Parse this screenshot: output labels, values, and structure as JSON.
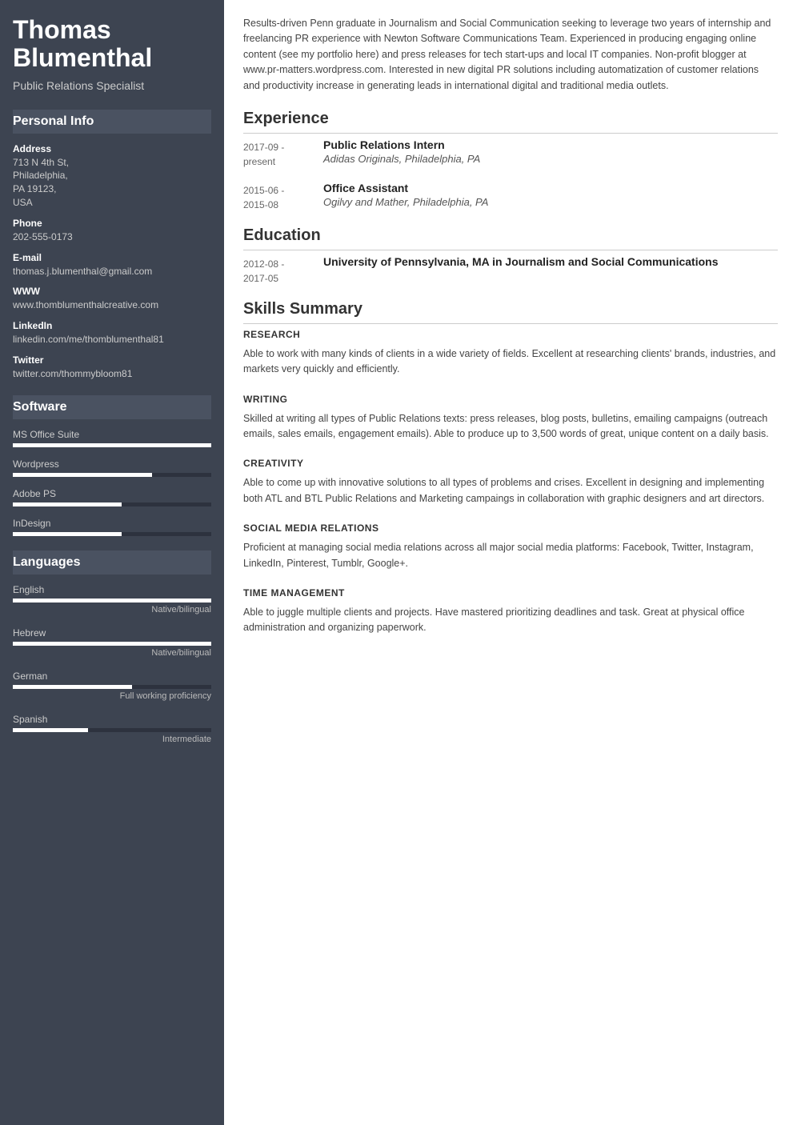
{
  "sidebar": {
    "name": "Thomas Blumenthal",
    "title": "Public Relations Specialist",
    "sections": {
      "personal_info": "Personal Info",
      "software": "Software",
      "languages": "Languages"
    },
    "personal": {
      "address_label": "Address",
      "address_value": "713 N 4th St, Philadelphia, PA 19123, USA",
      "phone_label": "Phone",
      "phone_value": "202-555-0173",
      "email_label": "E-mail",
      "email_value": "thomas.j.blumenthal@gmail.com",
      "www_label": "WWW",
      "www_value": "www.thomblumenthalcreative.com",
      "linkedin_label": "LinkedIn",
      "linkedin_value": "linkedin.com/me/thomblumenthal81",
      "twitter_label": "Twitter",
      "twitter_value": "twitter.com/thommybloom81"
    },
    "software": [
      {
        "name": "MS Office Suite",
        "fill_pct": 100,
        "dark_pct": 0
      },
      {
        "name": "Wordpress",
        "fill_pct": 70,
        "dark_pct": 30
      },
      {
        "name": "Adobe PS",
        "fill_pct": 55,
        "dark_pct": 45
      },
      {
        "name": "InDesign",
        "fill_pct": 55,
        "dark_pct": 45
      }
    ],
    "languages": [
      {
        "name": "English",
        "fill_pct": 100,
        "dark_pct": 0,
        "level": "Native/bilingual"
      },
      {
        "name": "Hebrew",
        "fill_pct": 100,
        "dark_pct": 0,
        "level": "Native/bilingual"
      },
      {
        "name": "German",
        "fill_pct": 60,
        "dark_pct": 40,
        "level": "Full working proficiency"
      },
      {
        "name": "Spanish",
        "fill_pct": 38,
        "dark_pct": 62,
        "level": "Intermediate"
      }
    ]
  },
  "main": {
    "summary": "Results-driven Penn graduate in Journalism and Social Communication seeking to leverage two years of internship and freelancing PR experience with Newton Software Communications Team. Experienced in producing engaging online content (see my portfolio here) and press releases for tech start-ups and local IT companies. Non-profit blogger at www.pr-matters.wordpress.com. Interested in new digital PR solutions including automatization of customer relations and productivity increase in generating leads in international digital and traditional media outlets.",
    "experience_title": "Experience",
    "experience": [
      {
        "date": "2017-09 - present",
        "title": "Public Relations Intern",
        "subtitle": "Adidas Originals, Philadelphia, PA"
      },
      {
        "date": "2015-06 - 2015-08",
        "title": "Office Assistant",
        "subtitle": "Ogilvy and Mather, Philadelphia, PA"
      }
    ],
    "education_title": "Education",
    "education": [
      {
        "date": "2012-08 - 2017-05",
        "title": "University of Pennsylvania, MA in Journalism and Social Communications",
        "subtitle": ""
      }
    ],
    "skills_title": "Skills Summary",
    "skills": [
      {
        "category": "RESEARCH",
        "text": "Able to work with many kinds of clients in a wide variety of fields. Excellent at researching clients' brands, industries, and markets very quickly and efficiently."
      },
      {
        "category": "WRITING",
        "text": "Skilled at writing all types of Public Relations texts: press releases, blog posts, bulletins, emailing campaigns (outreach emails, sales emails, engagement emails). Able to produce up to 3,500 words of great, unique content on a daily basis."
      },
      {
        "category": "CREATIVITY",
        "text": "Able to come up with innovative solutions to all types of problems and crises. Excellent in designing and implementing both ATL and BTL Public Relations and Marketing campaings in collaboration with graphic designers and art directors."
      },
      {
        "category": "SOCIAL MEDIA RELATIONS",
        "text": "Proficient at managing social media relations across all major social media platforms: Facebook, Twitter, Instagram, LinkedIn, Pinterest, Tumblr, Google+."
      },
      {
        "category": "TIME MANAGEMENT",
        "text": "Able to juggle multiple clients and projects. Have mastered prioritizing deadlines and task. Great at physical office administration and organizing paperwork."
      }
    ]
  }
}
